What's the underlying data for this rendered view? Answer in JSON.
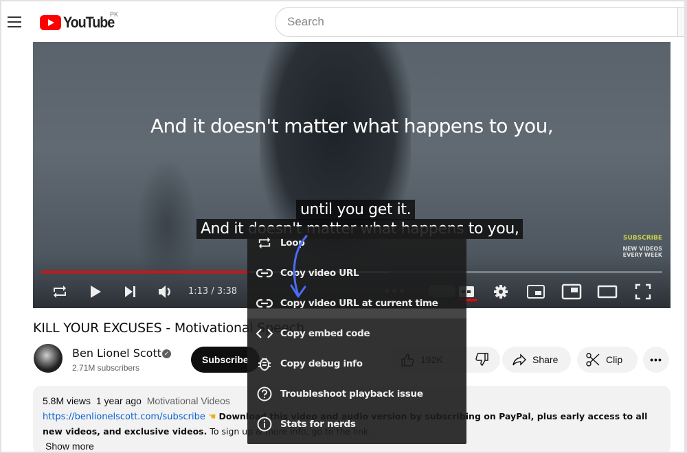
{
  "header": {
    "logo_text": "YouTube",
    "country_code": "PK",
    "search_placeholder": "Search"
  },
  "video": {
    "caption_top": "And it doesn't matter what happens to you,",
    "cc_line1": "until you get it.",
    "cc_line2": "And it doesn't matter what happens to you,",
    "endcard": {
      "subscribe": "SUBSCRIBE",
      "line1": "NEW VIDEOS",
      "line2": "EVERY WEEK"
    },
    "time_current": "1:13",
    "time_total": "3:38",
    "time_display": "1:13 / 3:38",
    "progress_played_fraction": 0.335,
    "progress_loaded_fraction": 0.56,
    "controls": [
      "loop-icon",
      "play-icon",
      "next-icon",
      "volume-icon",
      "autoplay-toggle",
      "captions-icon",
      "settings-icon",
      "miniplayer-icon",
      "pip-icon",
      "theater-icon",
      "fullscreen-icon"
    ]
  },
  "context_menu": {
    "items": [
      {
        "icon": "loop-icon",
        "label": "Loop"
      },
      {
        "icon": "link-icon",
        "label": "Copy video URL"
      },
      {
        "icon": "link-icon",
        "label": "Copy video URL at current time"
      },
      {
        "icon": "embed-code-icon",
        "label": "Copy embed code"
      },
      {
        "icon": "bug-icon",
        "label": "Copy debug info"
      },
      {
        "icon": "help-circle-icon",
        "label": "Troubleshoot playback issue"
      },
      {
        "icon": "info-icon",
        "label": "Stats for nerds"
      }
    ],
    "annotation_color": "#4a6cf7"
  },
  "details": {
    "title": "KILL YOUR EXCUSES - Motivational Speech",
    "channel_name": "Ben Lionel Scott",
    "subscribers": "2.71M subscribers",
    "subscribe_label": "Subscribe",
    "likes": "192K",
    "share_label": "Share",
    "clip_label": "Clip",
    "more_label": "•••"
  },
  "description": {
    "views": "5.8M views",
    "age": "1 year ago",
    "tag": "Motivational Videos",
    "link": "https://benlionelscott.com/subscribe",
    "bold_text_1": "Download this video and audio version by subscribing on PayPal, plus early access to all",
    "bold_text_2": "new videos, and exclusive videos.",
    "normal_text": " To sign up & more info, go to the link.",
    "show_more": "Show more"
  },
  "colors": {
    "brand_red": "#ff0000",
    "link_blue": "#065fd4",
    "menu_bg": "#1c1c1c"
  }
}
